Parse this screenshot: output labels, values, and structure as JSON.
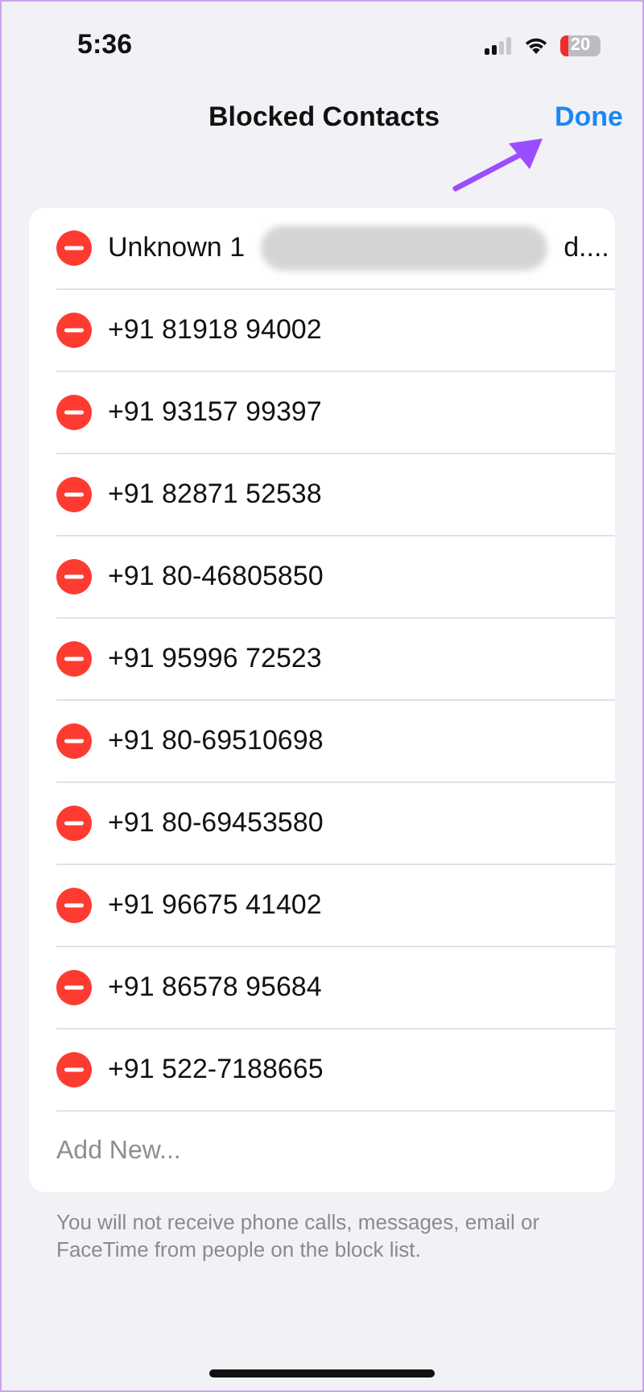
{
  "status_bar": {
    "time": "5:36",
    "battery": "20"
  },
  "nav": {
    "title": "Blocked Contacts",
    "done": "Done"
  },
  "contacts": [
    {
      "kind": "redacted",
      "name": "Unknown 1",
      "tail": "d...."
    },
    {
      "kind": "plain",
      "name": "+91 81918 94002"
    },
    {
      "kind": "plain",
      "name": "+91 93157 99397"
    },
    {
      "kind": "plain",
      "name": "+91 82871 52538"
    },
    {
      "kind": "plain",
      "name": "+91 80-46805850"
    },
    {
      "kind": "plain",
      "name": "+91 95996 72523"
    },
    {
      "kind": "plain",
      "name": "+91 80-69510698"
    },
    {
      "kind": "plain",
      "name": "+91 80-69453580"
    },
    {
      "kind": "plain",
      "name": "+91 96675 41402"
    },
    {
      "kind": "plain",
      "name": "+91 86578 95684"
    },
    {
      "kind": "plain",
      "name": "+91 522-7188665"
    }
  ],
  "add_new": "Add New...",
  "footer": "You will not receive phone calls, messages, email or FaceTime from people on the block list."
}
